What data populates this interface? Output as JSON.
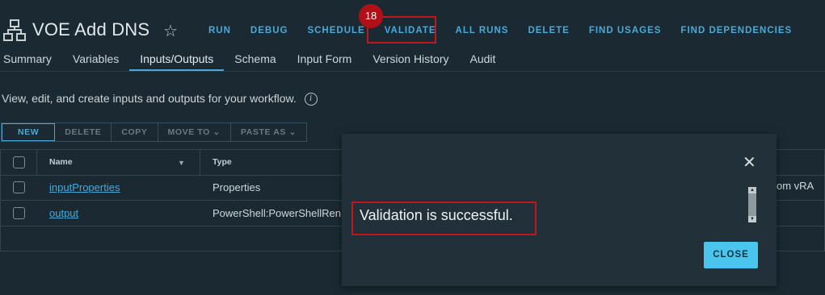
{
  "workflow": {
    "title": "VOE Add DNS",
    "icon": "workflow-tree-icon",
    "favorite_icon": "star-icon"
  },
  "actions": [
    "RUN",
    "DEBUG",
    "SCHEDULE",
    "VALIDATE",
    "ALL RUNS",
    "DELETE",
    "FIND USAGES",
    "FIND DEPENDENCIES"
  ],
  "step_badge": "18",
  "tabs": [
    "Summary",
    "Variables",
    "Inputs/Outputs",
    "Schema",
    "Input Form",
    "Version History",
    "Audit"
  ],
  "active_tab": "Inputs/Outputs",
  "description": "View, edit, and create inputs and outputs for your workflow.",
  "toolbar": {
    "new": "NEW",
    "delete": "DELETE",
    "copy": "COPY",
    "move_to": "MOVE TO",
    "paste_as": "PASTE AS"
  },
  "table": {
    "headers": {
      "name": "Name",
      "type": "Type"
    },
    "rows": [
      {
        "name": "inputProperties",
        "type": "Properties"
      },
      {
        "name": "output",
        "type": "PowerShell:PowerShellRen"
      }
    ],
    "trailing_text": "om vRA"
  },
  "modal": {
    "message": "Validation is successful.",
    "close_label": "CLOSE",
    "close_icon": "close-icon"
  },
  "colors": {
    "accent": "#4aa9d8",
    "highlight": "#c3161c",
    "close_button": "#49c5ee"
  }
}
